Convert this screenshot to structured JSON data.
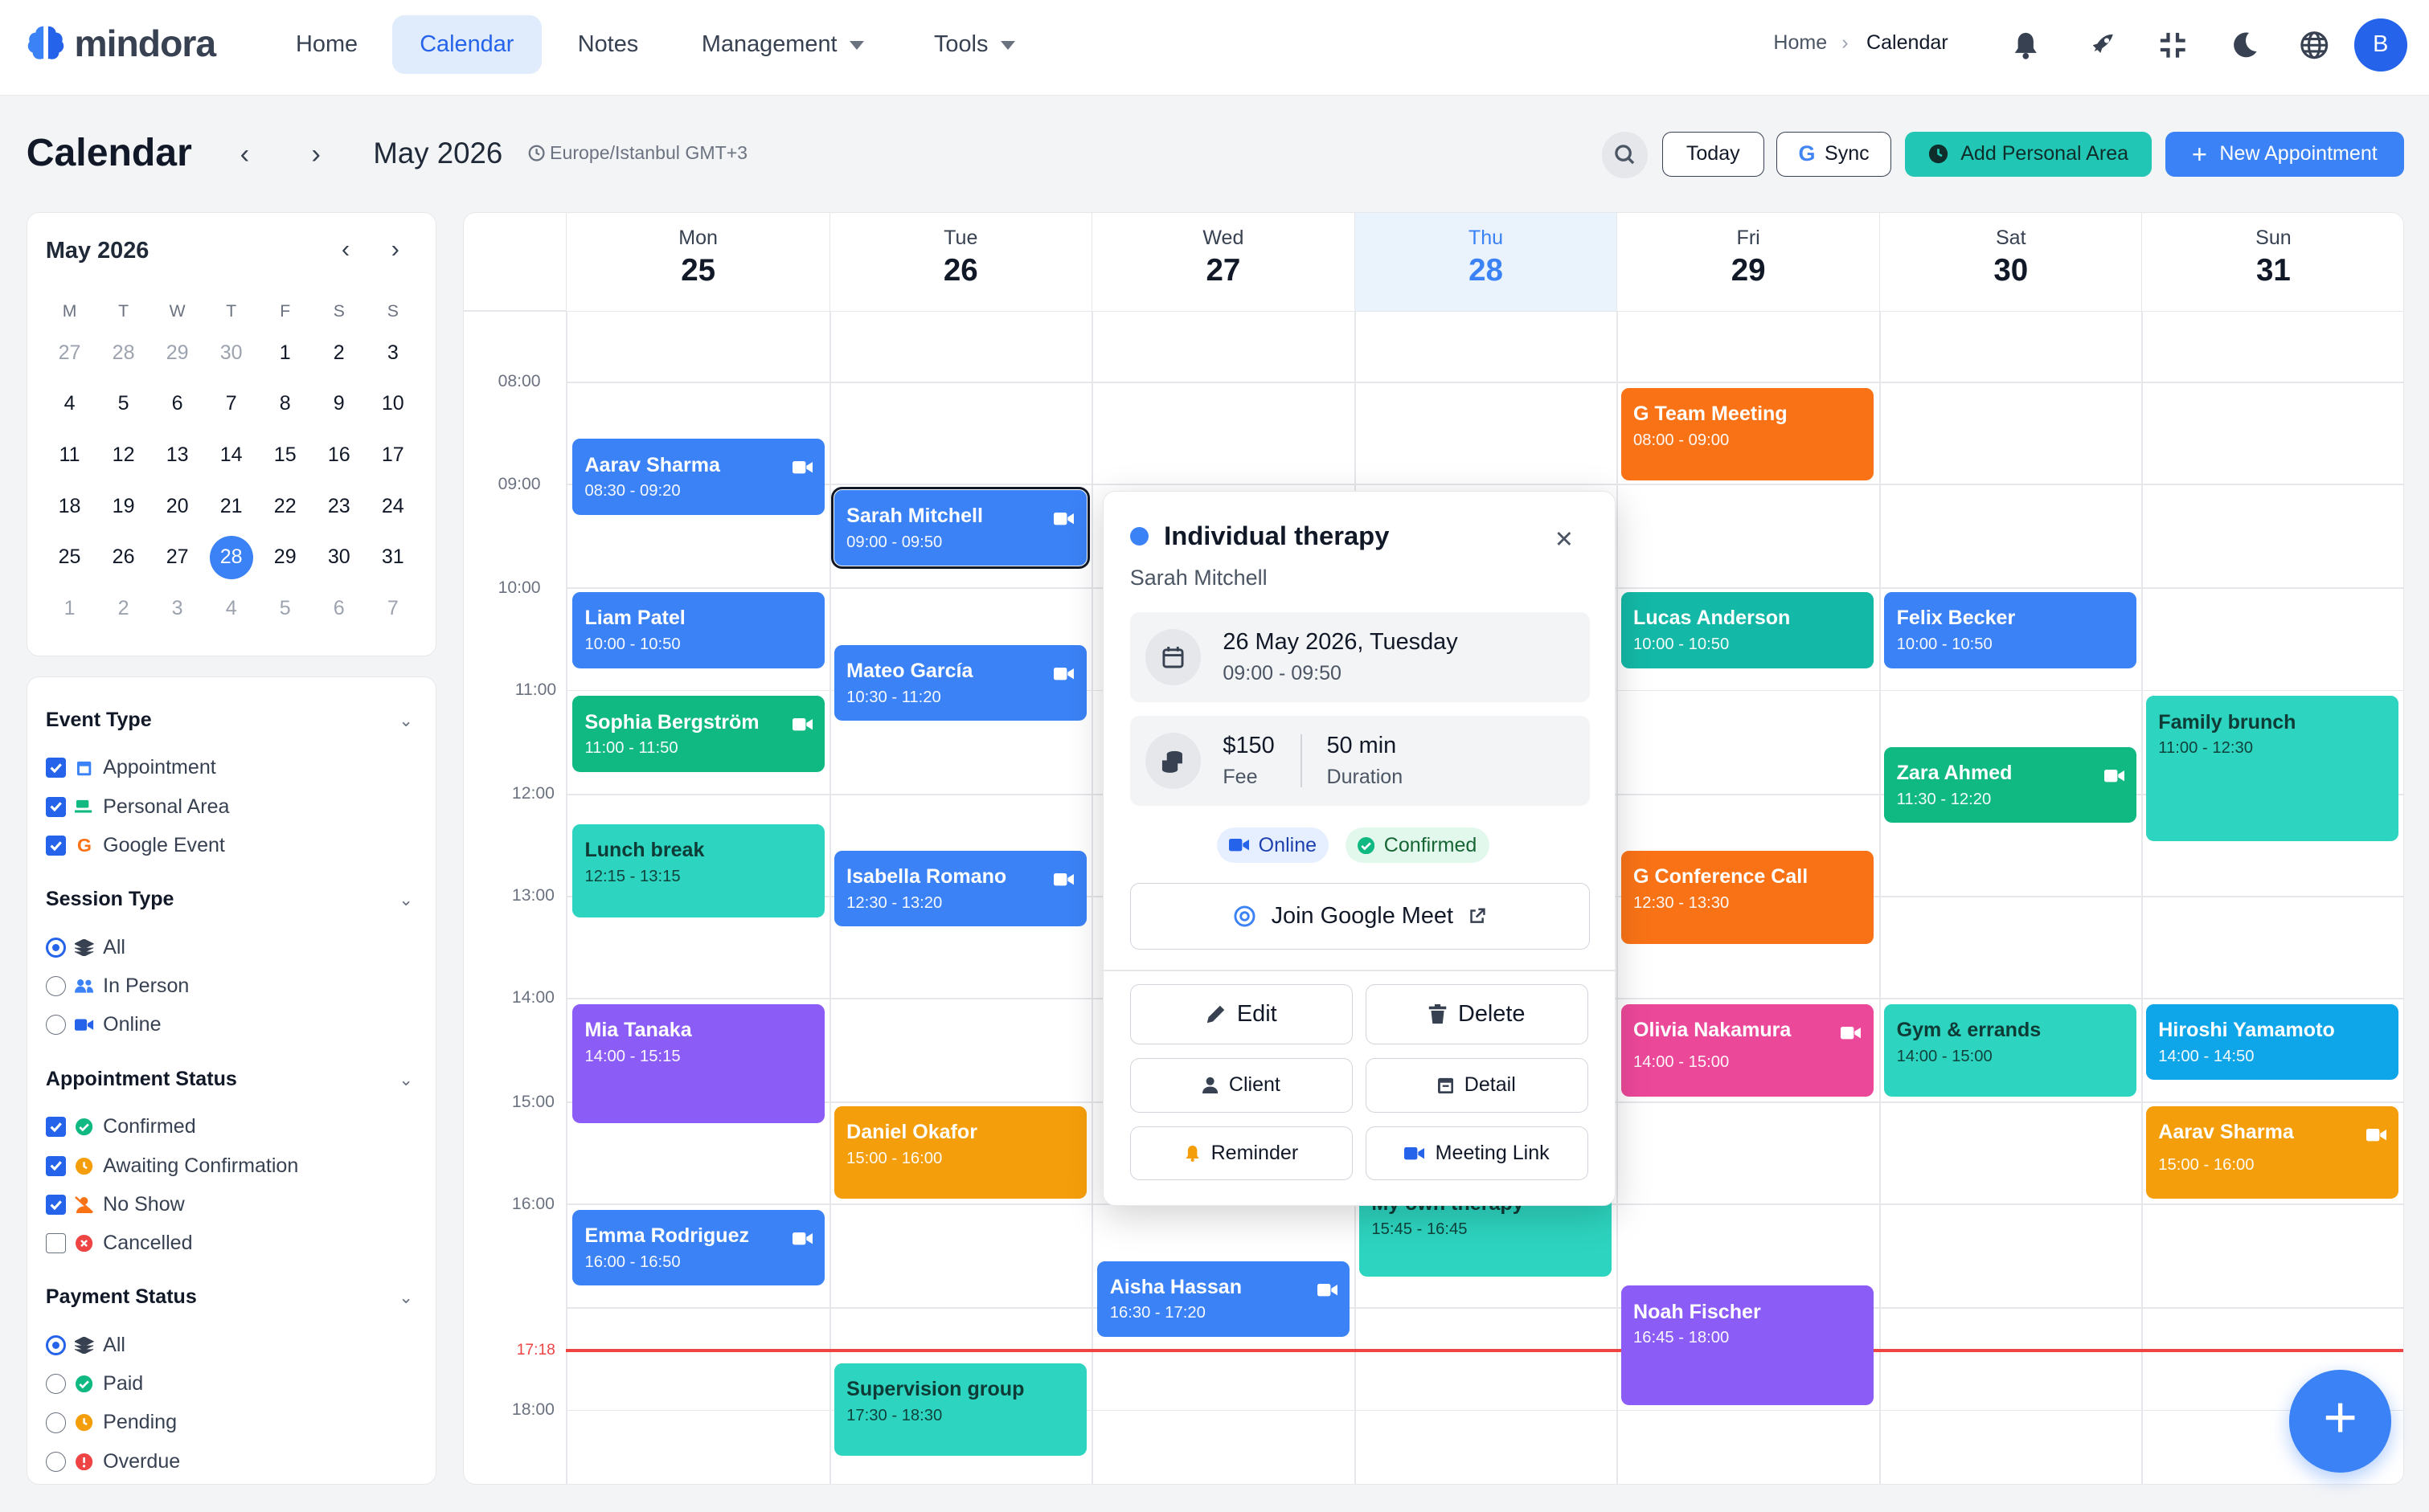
{
  "app": {
    "name": "mindora"
  },
  "nav": {
    "home": "Home",
    "calendar": "Calendar",
    "notes": "Notes",
    "management": "Management",
    "tools": "Tools"
  },
  "breadcrumb": {
    "home": "Home",
    "current": "Calendar"
  },
  "user": {
    "initial": "B"
  },
  "toolbar": {
    "title": "Calendar",
    "period": "May 2026",
    "timezone": "Europe/Istanbul GMT+3",
    "today": "Today",
    "sync": "Sync",
    "add_personal": "Add Personal Area",
    "new_appointment": "New Appointment"
  },
  "mini_calendar": {
    "title": "May 2026",
    "weekdays": [
      "M",
      "T",
      "W",
      "T",
      "F",
      "S",
      "S"
    ],
    "weeks": [
      [
        "27",
        "28",
        "29",
        "30",
        "1",
        "2",
        "3"
      ],
      [
        "4",
        "5",
        "6",
        "7",
        "8",
        "9",
        "10"
      ],
      [
        "11",
        "12",
        "13",
        "14",
        "15",
        "16",
        "17"
      ],
      [
        "18",
        "19",
        "20",
        "21",
        "22",
        "23",
        "24"
      ],
      [
        "25",
        "26",
        "27",
        "28",
        "29",
        "30",
        "31"
      ],
      [
        "1",
        "2",
        "3",
        "4",
        "5",
        "6",
        "7"
      ]
    ],
    "selected": "28"
  },
  "filters": {
    "event_type": {
      "title": "Event Type",
      "items": [
        "Appointment",
        "Personal Area",
        "Google Event"
      ]
    },
    "session_type": {
      "title": "Session Type",
      "items": [
        "All",
        "In Person",
        "Online"
      ]
    },
    "appointment_status": {
      "title": "Appointment Status",
      "items": [
        "Confirmed",
        "Awaiting Confirmation",
        "No Show",
        "Cancelled"
      ]
    },
    "payment_status": {
      "title": "Payment Status",
      "items": [
        "All",
        "Paid",
        "Pending",
        "Overdue"
      ]
    }
  },
  "week": {
    "days": [
      {
        "name": "Mon",
        "num": "25"
      },
      {
        "name": "Tue",
        "num": "26"
      },
      {
        "name": "Wed",
        "num": "27"
      },
      {
        "name": "Thu",
        "num": "28"
      },
      {
        "name": "Fri",
        "num": "29"
      },
      {
        "name": "Sat",
        "num": "30"
      },
      {
        "name": "Sun",
        "num": "31"
      }
    ],
    "hours": [
      "08:00",
      "09:00",
      "10:00",
      "11:00",
      "12:00",
      "13:00",
      "14:00",
      "15:00",
      "16:00",
      "18:00"
    ],
    "now": "17:18"
  },
  "events": {
    "e1": {
      "title": "Aarav Sharma",
      "time": "08:30 - 09:20"
    },
    "e2": {
      "title": "Liam Patel",
      "time": "10:00 - 10:50"
    },
    "e3": {
      "title": "Sophia Bergström",
      "time": "11:00 - 11:50"
    },
    "e4": {
      "title": "Lunch break",
      "time": "12:15 - 13:15"
    },
    "e5": {
      "title": "Mia Tanaka",
      "time": "14:00 - 15:15"
    },
    "e6": {
      "title": "Emma Rodriguez",
      "time": "16:00 - 16:50"
    },
    "e7": {
      "title": "Sarah Mitchell",
      "time": "09:00 - 09:50"
    },
    "e8": {
      "title": "Mateo García",
      "time": "10:30 - 11:20"
    },
    "e9": {
      "title": "Isabella Romano",
      "time": "12:30 - 13:20"
    },
    "e10": {
      "title": "Daniel Okafor",
      "time": "15:00 - 16:00"
    },
    "e11": {
      "title": "Supervision group",
      "time": "17:30 - 18:30"
    },
    "e12": {
      "title": "Aisha Hassan",
      "time": "16:30 - 17:20"
    },
    "e13": {
      "title": "My own therapy",
      "time": "15:45 - 16:45"
    },
    "e14": {
      "title": "Team Meeting",
      "time": "08:00 - 09:00"
    },
    "e15": {
      "title": "Lucas Anderson",
      "time": "10:00 - 10:50"
    },
    "e16": {
      "title": "Conference Call",
      "time": "12:30 - 13:30"
    },
    "e17": {
      "title": "Olivia Nakamura",
      "time": "14:00 - 15:00"
    },
    "e18": {
      "title": "Noah Fischer",
      "time": "16:45 - 18:00"
    },
    "e19": {
      "title": "Felix Becker",
      "time": "10:00 - 10:50"
    },
    "e20": {
      "title": "Zara Ahmed",
      "time": "11:30 - 12:20"
    },
    "e21": {
      "title": "Gym & errands",
      "time": "14:00 - 15:00"
    },
    "e22": {
      "title": "Family brunch",
      "time": "11:00 - 12:30"
    },
    "e23": {
      "title": "Hiroshi Yamamoto",
      "time": "14:00 - 14:50"
    },
    "e24": {
      "title": "Aarav Sharma",
      "time": "15:00 - 16:00"
    }
  },
  "popup": {
    "title": "Individual therapy",
    "client": "Sarah Mitchell",
    "date": "26 May 2026, Tuesday",
    "time": "09:00 - 09:50",
    "fee": "$150",
    "fee_label": "Fee",
    "duration": "50 min",
    "duration_label": "Duration",
    "mode": "Online",
    "status": "Confirmed",
    "join": "Join Google Meet",
    "edit": "Edit",
    "delete": "Delete",
    "client_btn": "Client",
    "detail": "Detail",
    "reminder": "Reminder",
    "meeting_link": "Meeting Link"
  },
  "colors": {
    "primary": "#3b82f6",
    "teal": "#2dd4bf",
    "now": "#ef4444"
  }
}
